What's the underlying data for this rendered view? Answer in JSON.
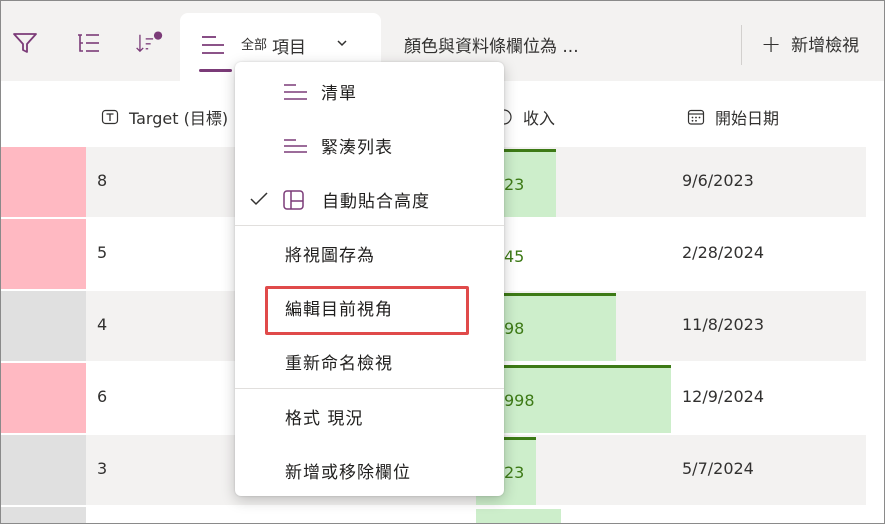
{
  "toolbar": {
    "active_view": {
      "prefix": "全部",
      "label": "項目"
    },
    "other_view_label": "顏色與資料條欄位為 ...",
    "new_view_label": "新增檢視"
  },
  "columns": {
    "target": "Target (目標)",
    "income": "收入",
    "start_date": "開始日期"
  },
  "rows": [
    {
      "target": "8",
      "income": "23",
      "date": "9/6/2023",
      "swatch_color": "#ffb9c2",
      "bar_fraction": 0.41,
      "shaded": true
    },
    {
      "target": "5",
      "income": "45",
      "date": "2/28/2024",
      "swatch_color": "#ffb9c2",
      "bar_fraction": 0.14,
      "shaded": false
    },
    {
      "target": "4",
      "income": "98",
      "date": "11/8/2023",
      "swatch_color": "#e0e0e0",
      "bar_fraction": 0.72,
      "shaded": true
    },
    {
      "target": "6",
      "income": "998",
      "date": "12/9/2024",
      "swatch_color": "#ffb9c2",
      "bar_fraction": 1.0,
      "shaded": false
    },
    {
      "target": "3",
      "income": "23",
      "date": "5/7/2024",
      "swatch_color": "#e0e0e0",
      "bar_fraction": 0.31,
      "shaded": true
    }
  ],
  "menu": {
    "list": "清單",
    "compact_list": "緊湊列表",
    "autofit_height": "自動貼合高度",
    "save_view_as": "將視圖存為",
    "edit_current_view": "編輯目前視角",
    "rename_view": "重新命名檢視",
    "format_view": "格式 現況",
    "add_remove_columns": "新增或移除欄位"
  },
  "colors": {
    "accent": "#7b3b78",
    "bar_fill": "#cdeecb",
    "bar_text": "#3d7a16",
    "highlight_box": "#e04a4a"
  }
}
